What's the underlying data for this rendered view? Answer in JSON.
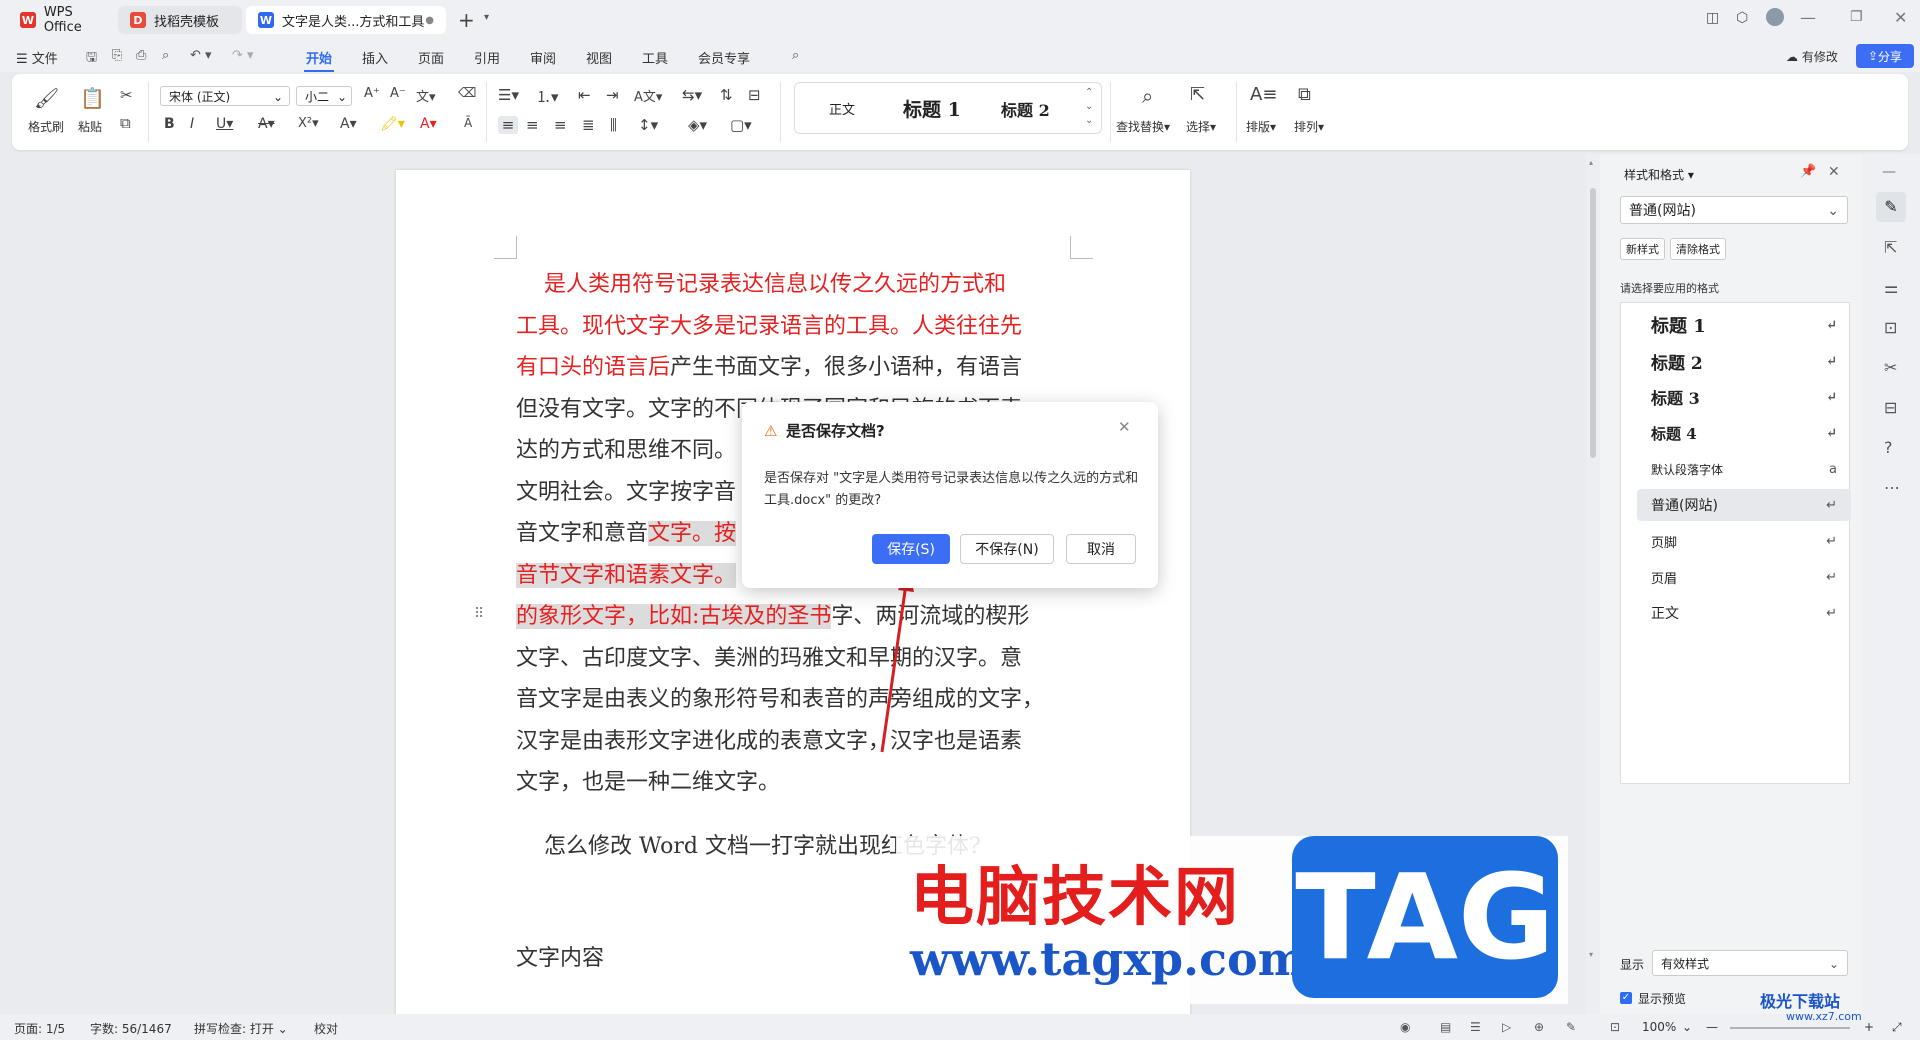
{
  "tabs": [
    {
      "label": "WPS Office"
    },
    {
      "label": "找稻壳模板"
    },
    {
      "label": "文字是人类...方式和工具"
    }
  ],
  "menubar": {
    "file": "文件",
    "items": [
      "开始",
      "插入",
      "页面",
      "引用",
      "审阅",
      "视图",
      "工具",
      "会员专享"
    ],
    "active": "开始",
    "has_changes": "有修改",
    "share": "分享"
  },
  "ribbon": {
    "format_painter": "格式刷",
    "paste": "粘贴",
    "font_name": "宋体 (正文)",
    "font_size": "小二",
    "style_normal": "正文",
    "style_h1": "标题 1",
    "style_h2": "标题 2",
    "find_replace": "查找替换",
    "select": "选择",
    "layout": "排版",
    "arrange": "排列"
  },
  "document": {
    "lines": [
      "是人类用符号记录表达信息以传之久远的方式和",
      "工具。现代文字大多是记录语言的工具。人类往往先",
      "有口头的语言后",
      "产生书面文字，很多小语种，有语言",
      "但没有文字。文字的不同体现了国家和民族的书面表",
      "达的方式和思维不同。",
      "文明社会。文字按字音",
      "音文字和意音",
      "文字。按",
      "音节文字和语素文字。",
      "的象形文字，比如:古埃及的圣书",
      "字、两河流域的楔形",
      "文字、古印度文字、美洲的玛雅文和早期的汉字。意",
      "音文字是由表义的象形符号和表音的声旁组成的文字，",
      "汉字是由表形文字进化成的表意文字，汉字也是语素",
      "文字，也是一种二维文字。"
    ],
    "question": "怎么修改 Word 文档一打字就出现红色字体?",
    "heading": "文字内容"
  },
  "dialog": {
    "title": "是否保存文档?",
    "message": "是否保存对 \"文字是人类用符号记录表达信息以传之久远的方式和工具.docx\" 的更改?",
    "save": "保存(S)",
    "dont_save": "不保存(N)",
    "cancel": "取消"
  },
  "panel": {
    "title": "样式和格式",
    "current_style": "普通(网站)",
    "new_style": "新样式",
    "clear_format": "清除格式",
    "hint": "请选择要应用的格式",
    "styles": [
      "标题 1",
      "标题 2",
      "标题 3",
      "标题 4",
      "默认段落字体",
      "普通(网站)",
      "页脚",
      "页眉",
      "正文"
    ],
    "display_label": "显示",
    "display_value": "有效样式",
    "show_preview": "显示预览"
  },
  "statusbar": {
    "page": "页面: 1/5",
    "words": "字数: 56/1467",
    "spell": "拼写检查: 打开",
    "proof": "校对",
    "zoom": "100%"
  },
  "watermark": {
    "text": "电脑技术网",
    "url": "www.tagxp.com",
    "tag": "TAG",
    "corner": "极光下载站",
    "corner_url": "www.xz7.com"
  },
  "colors": {
    "accent": "#3b6ef5",
    "red_text": "#e52121",
    "wps_red": "#e5352b"
  }
}
